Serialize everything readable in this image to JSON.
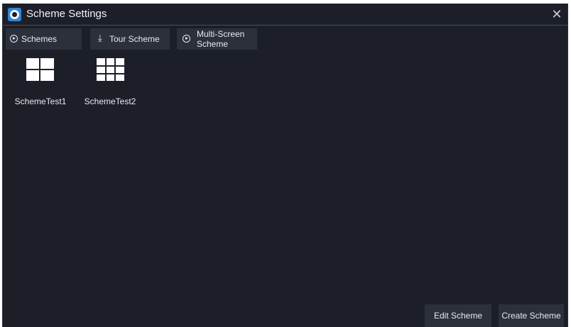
{
  "window": {
    "title": "Scheme Settings",
    "close_symbol": "✕"
  },
  "tabs": [
    {
      "label": "Schemes",
      "icon": "play-circle-icon"
    },
    {
      "label": "Tour Scheme",
      "icon": "download-icon"
    },
    {
      "label_line1": "Multi-Screen",
      "label_line2": "Scheme",
      "icon": "play-circle-icon"
    }
  ],
  "schemes": [
    {
      "name": "SchemeTest1",
      "layout": "2x2"
    },
    {
      "name": "SchemeTest2",
      "layout": "3x3"
    }
  ],
  "buttons": {
    "edit": "Edit Scheme",
    "create": "Create Scheme"
  },
  "colors": {
    "background": "#1c1f28",
    "panel": "#2c303b",
    "accent": "#2f86d8",
    "text": "#e8eaef"
  }
}
